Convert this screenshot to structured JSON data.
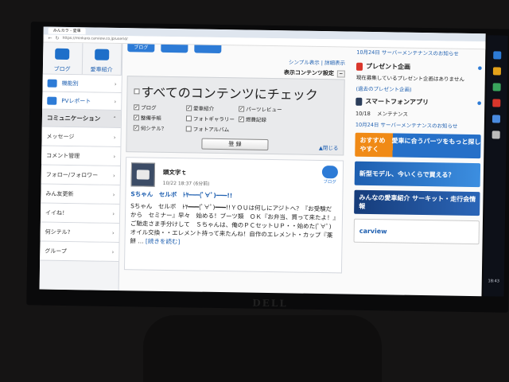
{
  "browser": {
    "tab_title": "みんカラ - 愛車",
    "url": "https://minkara.carview.co.jp/userid/"
  },
  "sidebar": {
    "top_icons": [
      {
        "label": "ブログ"
      },
      {
        "label": "愛車紹介"
      }
    ],
    "links": [
      {
        "label": "機能別"
      },
      {
        "label": "PVレポート"
      }
    ],
    "section": "コミュニケーション",
    "items": [
      "メッセージ",
      "コメント管理",
      "フォロー/フォロワー",
      "みん友更新",
      "イイね！",
      "何シテル？",
      "グループ"
    ]
  },
  "main": {
    "tabs": [
      "ブログ"
    ],
    "view_links": "シンプル表示 | 詳細表示",
    "display_settings": "表示コンテンツ設定",
    "check_all": "すべてのコンテンツにチェック",
    "checkboxes": [
      {
        "label": "ブログ",
        "checked": true
      },
      {
        "label": "愛車紹介",
        "checked": true
      },
      {
        "label": "パーツレビュー",
        "checked": true
      },
      {
        "label": "整備手帳",
        "checked": true
      },
      {
        "label": "フォトギャラリー",
        "checked": false
      },
      {
        "label": "燃費記録",
        "checked": true
      },
      {
        "label": "何シテル？",
        "checked": true
      },
      {
        "label": "フォトアルバム",
        "checked": false
      }
    ],
    "register": "登 録",
    "close": "▲閉じる",
    "post": {
      "author": "頭文字ｔ",
      "meta": "10/22 18:37 (6分前)",
      "badge": "ブログ",
      "title": "Sちゃん　セルボ　ﾄﾔ━━━(ﾟ∀ﾟ)━━━!!",
      "body": "Sちゃん　セルボ　ﾄﾔ━━━(ﾟ∀ﾟ)━━━!!ＹＯＵは何しにアジトへ？『お受験だから　セミナー』早々　始める！ブーツ類　ＯＫ『お弁当、買って来たよ！』ご馳走さま手分けして　Ｓちゃんは、俺のＰＣセットＵＰ・・始めた(ﾟ∀ﾟ)　オイル交換・・エレメント持って来たんね！自作のエレメント・カップ『薬餅 ... ",
      "more": "[続きを読む]"
    }
  },
  "right": {
    "top_info": "10月24日 サーバーメンテナンスのお知らせ",
    "present": {
      "title": "プレゼント企画",
      "text": "現在募集しているプレゼント企画はありません",
      "link": "(過去のプレゼント企画)"
    },
    "app": {
      "title": "スマートフォンアプリ",
      "date": "10/18",
      "news": "メンテナンス",
      "link": "10月24日 サーバーメンテナンスのお知らせ"
    },
    "ads": [
      "おすすめ　愛車に合うパーツをもっと探しやすく",
      "新型モデル、今いくらで買える？",
      "みんなの愛車紹介 サーキット・走行会情報",
      "carview"
    ]
  },
  "taskbar": {
    "time": "18:43"
  },
  "monitor_brand": "DELL",
  "colors": {
    "accent": "#2d7bd6",
    "link": "#1e5fb0",
    "screen_bg": "#fafafa"
  }
}
